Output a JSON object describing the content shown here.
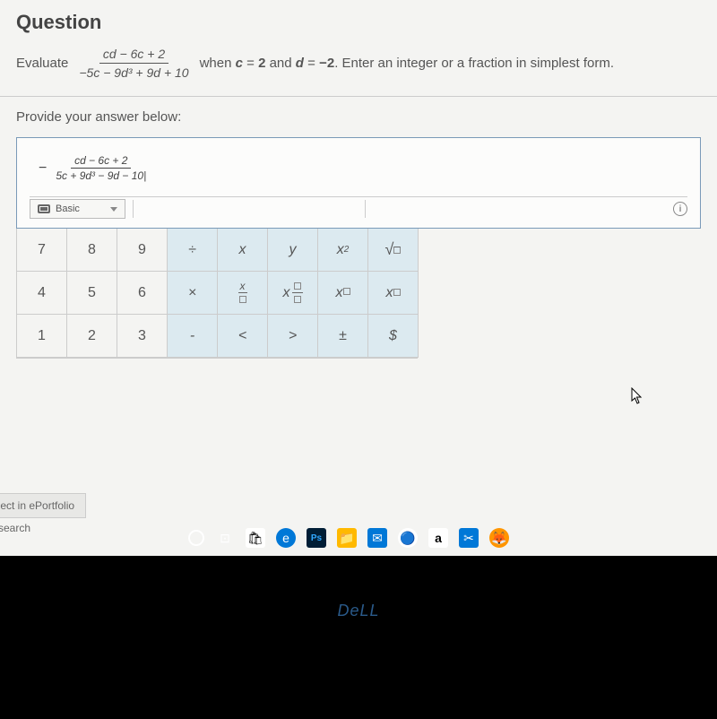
{
  "question": {
    "title": "Question",
    "eval_word": "Evaluate",
    "numerator": "cd − 6c + 2",
    "denominator": "−5c − 9d³ + 9d + 10",
    "trail_pre": " when ",
    "var1": "c",
    "eq1": " = ",
    "val1": "2",
    "and": " and ",
    "var2": "d",
    "eq2": " = ",
    "val2": "−2",
    "trail_post": ". Enter an integer or a fraction in simplest form."
  },
  "provide": "Provide your answer below:",
  "answer": {
    "neg": "−",
    "num": "cd − 6c + 2",
    "den": "5c + 9d³ − 9d − 10|"
  },
  "toolbar": {
    "basic": "Basic"
  },
  "keypad": {
    "r1": [
      "7",
      "8",
      "9",
      "÷",
      "x",
      "y",
      "x²",
      "√☐"
    ],
    "r2": [
      "4",
      "5",
      "6",
      "×",
      "x/☐",
      "x=☐",
      "x☐",
      "x₍☐₎"
    ],
    "r3": [
      "1",
      "2",
      "3",
      "-",
      "<",
      ">",
      "±",
      "$"
    ]
  },
  "port": "llect in ePortfolio",
  "search": "o search",
  "dell": "DeLL",
  "tb_icons": [
    "o",
    "task",
    "store",
    "edge",
    "ps",
    "folder",
    "mail",
    "chrome",
    "amz",
    "snip",
    "firefox"
  ]
}
